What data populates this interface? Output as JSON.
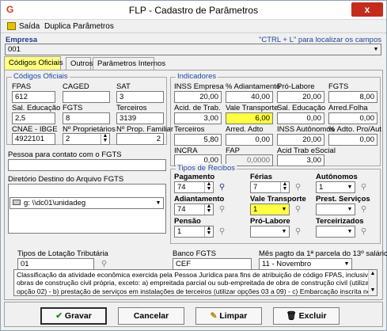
{
  "window": {
    "title": "FLP - Cadastro de Parâmetros",
    "close": "x"
  },
  "menu": {
    "items": [
      "Saída",
      "Duplica Parâmetros"
    ]
  },
  "empresa": {
    "label": "Empresa",
    "hint": "\"CTRL + L\" para localizar os campos",
    "value": "001"
  },
  "tabs": [
    "Códigos Oficiais",
    "Outros",
    "Parâmetros Internos"
  ],
  "codigos": {
    "title": "Códigos Oficiais",
    "fpas_label": "FPAS",
    "fpas": "612",
    "caged_label": "CAGED",
    "caged": "",
    "sat_label": "SAT",
    "sat": "3",
    "sal_edu_label": "Sal. Educação",
    "sal_edu": "2,5",
    "fgts_label": "FGTS",
    "fgts": "8",
    "terceiros_label": "Terceiros",
    "terceiros": "3139",
    "cnae_label": "CNAE - IBGE",
    "cnae": "4922101",
    "nprop_label": "Nº Proprietários",
    "nprop": "2",
    "npropfam_label": "Nº Prop. Familiar",
    "npropfam": "2"
  },
  "indicadores": {
    "title": "Indicadores",
    "inss_emp_label": "INSS Empresa",
    "inss_emp": "20,00",
    "adiant_label": "% Adiantamento",
    "adiant": "40,00",
    "prolabore_label": "Pró-Labore",
    "prolabore": "20,00",
    "fgts_label": "FGTS",
    "fgts": "8,00",
    "acid_label": "Acid. de Trab.",
    "acid": "3,00",
    "vt_label": "Vale Transporte",
    "vt": "6,00",
    "saledu_label": "Sal. Educação",
    "saledu": "0,00",
    "arredfolha_label": "Arred.Folha",
    "arredfolha": "0,00",
    "terceiros_label": "Terceiros",
    "terceiros": "5,80",
    "arredadto_label": "Arred. Adto",
    "arredadto": "0,00",
    "inssaut_label": "INSS Autônomos",
    "inssaut": "20,00",
    "adtoprout_label": "% Adto. Pro/Aut",
    "adtoprout": "0,00",
    "incra_label": "INCRA",
    "incra": "0,00",
    "fap_label": "FAP",
    "fap": "0,0000",
    "acidesocial_label": "Acid Trab eSocial",
    "acidesocial": "3,00"
  },
  "contato": {
    "label": "Pessoa para contato com o FGTS",
    "value": ""
  },
  "diretorio": {
    "label": "Diretório Destino do Arquivo FGTS",
    "value": "",
    "drive": "g: \\\\dc01\\unidadeg"
  },
  "recibos": {
    "title": "Tipos de Recibos",
    "pagamento_label": "Pagamento",
    "pagamento": "74",
    "ferias_label": "Férias",
    "ferias": "7",
    "autonomos_label": "Autônomos",
    "autonomos": "1",
    "adiantamento_label": "Adiantamento",
    "adiantamento": "74",
    "vt_label": "Vale Transporte",
    "vt": "1",
    "prest_label": "Prest. Serviços",
    "prest": "",
    "pensao_label": "Pensão",
    "pensao": "1",
    "prolabore_label": "Pró-Labore",
    "prolabore": "",
    "terceirizados_label": "Terceirizados",
    "terceirizados": ""
  },
  "lotacao": {
    "label": "Tipos de Lotação Tributária",
    "value": "01"
  },
  "banco": {
    "label": "Banco FGTS",
    "value": "CEF"
  },
  "mes13": {
    "label": "Mês pagto da 1ª parcela do 13º salário",
    "value": "11 - Novembro"
  },
  "memo": "Classificação da atividade econômica exercida pela Pessoa Jurídica para fins de atribuição de código FPAS, inclusive obras de construção civil própria, exceto: a) empreitada parcial ou sub-empreitada de obra de construção civil (utilizar opção 02) - b) prestação de serviços em instalações de terceiros (utilizar opções 03 a 09) - c) Embarcação inscrita no Registro Especial",
  "buttons": {
    "gravar": "Gravar",
    "cancelar": "Cancelar",
    "limpar": "Limpar",
    "excluir": "Excluir"
  }
}
